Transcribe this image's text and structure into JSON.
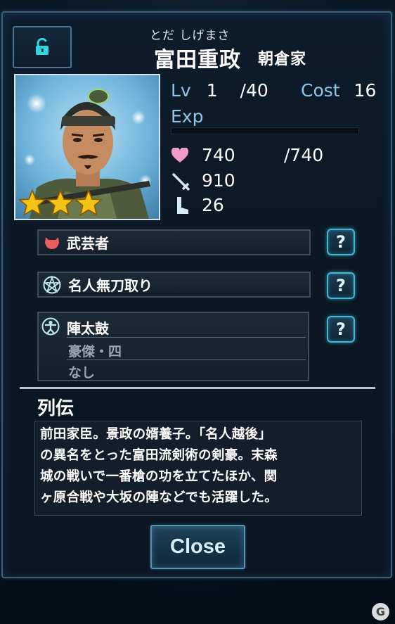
{
  "header": {
    "furigana": "とだ しげまさ",
    "name": "富田重政",
    "clan": "朝倉家"
  },
  "lock": {
    "icon": "unlocked-padlock-icon",
    "color": "#2fd6e2"
  },
  "portrait": {
    "rarity_stars": 3
  },
  "stats": {
    "lv_label": "Lv",
    "lv_value": "1",
    "lv_max": "/40",
    "cost_label": "Cost",
    "cost_value": "16",
    "exp_label": "Exp",
    "exp_progress": 0,
    "hp": "740",
    "hp_max": "/740",
    "attack": "910",
    "speed": "26"
  },
  "skills": [
    {
      "icon": "oni-mask-icon",
      "label": "武芸者",
      "help": "?"
    },
    {
      "icon": "pentagram-icon",
      "label": "名人無刀取り",
      "help": "?"
    }
  ],
  "tactic": {
    "icon": "figure-icon",
    "label": "陣太鼓",
    "line1": "豪傑・四",
    "line2": "なし",
    "help": "?"
  },
  "biography": {
    "title": "列伝",
    "lines": [
      "前田家臣。景政の婿養子。「名人越後」",
      "の異名をとった富田流剣術の剣豪。末森",
      "城の戦いで一番槍の功を立てたほか、関",
      "ヶ原合戦や大坂の陣などでも活躍した。"
    ]
  },
  "close_label": "Close",
  "watermark": "G",
  "colors": {
    "accent_cyan": "#3fb8d8",
    "stat_label": "#8fc6e6",
    "star_gold": "#f3c316"
  }
}
